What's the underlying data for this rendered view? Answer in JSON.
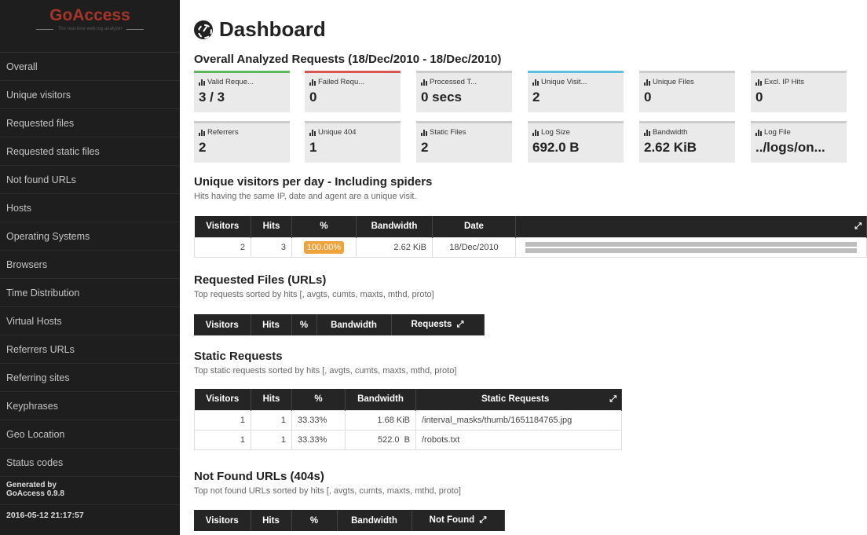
{
  "sidebar": {
    "logo": "GoAccess",
    "tagline": "The real-time web log analyzer",
    "items": [
      {
        "label": "Overall"
      },
      {
        "label": "Unique visitors"
      },
      {
        "label": "Requested files"
      },
      {
        "label": "Requested static files"
      },
      {
        "label": "Not found URLs"
      },
      {
        "label": "Hosts"
      },
      {
        "label": "Operating Systems"
      },
      {
        "label": "Browsers"
      },
      {
        "label": "Time Distribution"
      },
      {
        "label": "Virtual Hosts"
      },
      {
        "label": "Referrers URLs"
      },
      {
        "label": "Referring sites"
      },
      {
        "label": "Keyphrases"
      },
      {
        "label": "Geo Location"
      },
      {
        "label": "Status codes"
      }
    ],
    "generated_line1": "Generated by",
    "generated_line2": "GoAccess 0.9.8",
    "dash": "—",
    "timestamp": "2016-05-12 21:17:57"
  },
  "page": {
    "title": "Dashboard"
  },
  "overall": {
    "heading": "Overall Analyzed Requests (18/Dec/2010 - 18/Dec/2010)",
    "stats": [
      {
        "label": "Valid Reque...",
        "value": "3 / 3",
        "accent": "#5cb85c"
      },
      {
        "label": "Failed Requ...",
        "value": "0",
        "accent": "#d9534f"
      },
      {
        "label": "Processed T...",
        "value": "0 secs",
        "accent": "#cccccc"
      },
      {
        "label": "Unique Visit...",
        "value": "2",
        "accent": "#5bc0de"
      },
      {
        "label": "Unique Files",
        "value": "0",
        "accent": "#cccccc"
      },
      {
        "label": "Excl. IP Hits",
        "value": "0",
        "accent": "#cccccc"
      },
      {
        "label": "Referrers",
        "value": "2",
        "accent": "#cccccc"
      },
      {
        "label": "Unique 404",
        "value": "1",
        "accent": "#cccccc"
      },
      {
        "label": "Static Files",
        "value": "2",
        "accent": "#cccccc"
      },
      {
        "label": "Log Size",
        "value": "692.0 B",
        "accent": "#cccccc"
      },
      {
        "label": "Bandwidth",
        "value": "2.62 KiB",
        "accent": "#cccccc"
      },
      {
        "label": "Log File",
        "value": "../logs/on...",
        "accent": "#cccccc"
      }
    ]
  },
  "visitors": {
    "heading": "Unique visitors per day - Including spiders",
    "sub": "Hits having the same IP, date and agent are a unique visit.",
    "headers": [
      "Visitors",
      "Hits",
      "%",
      "Bandwidth",
      "Date"
    ],
    "row": {
      "visitors": "2",
      "hits": "3",
      "pct": "100.00%",
      "bandwidth": "2.62 KiB",
      "date": "18/Dec/2010",
      "bar_fraction": 1.0
    }
  },
  "requested": {
    "heading": "Requested Files (URLs)",
    "sub": "Top requests sorted by hits [, avgts, cumts, maxts, mthd, proto]",
    "headers": [
      "Visitors",
      "Hits",
      "%",
      "Bandwidth",
      "Requests"
    ]
  },
  "static": {
    "heading": "Static Requests",
    "sub": "Top static requests sorted by hits [, avgts, cumts, maxts, mthd, proto]",
    "headers": [
      "Visitors",
      "Hits",
      "%",
      "Bandwidth",
      "Static Requests"
    ],
    "rows": [
      {
        "visitors": "1",
        "hits": "1",
        "pct": "33.33%",
        "bandwidth": "1.68 KiB",
        "req": "/interval_masks/thumb/1651184765.jpg"
      },
      {
        "visitors": "1",
        "hits": "1",
        "pct": "33.33%",
        "bandwidth": "522.0  B",
        "req": "/robots.txt"
      }
    ]
  },
  "notfound": {
    "heading": "Not Found URLs (404s)",
    "sub": "Top not found URLs sorted by hits [, avgts, cumts, maxts, mthd, proto]",
    "headers": [
      "Visitors",
      "Hits",
      "%",
      "Bandwidth",
      "Not Found"
    ]
  }
}
